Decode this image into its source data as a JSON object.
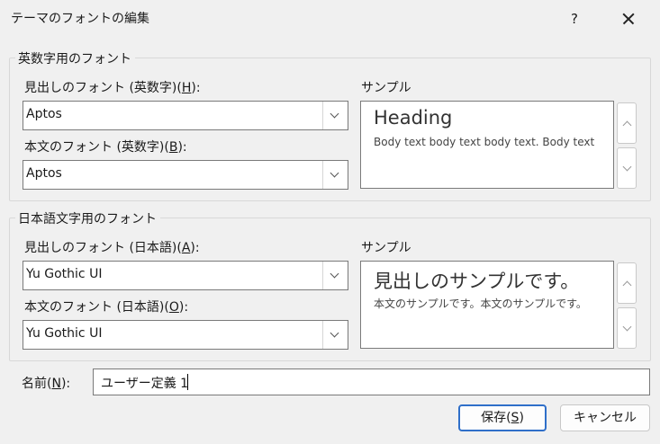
{
  "window": {
    "title": "テーマのフォントの編集",
    "help": "?"
  },
  "latin": {
    "group_label": "英数字用のフォント",
    "heading_label_pre": "見出しのフォント (英数字)(",
    "heading_label_key": "H",
    "heading_label_post": "):",
    "heading_value": "Aptos",
    "body_label_pre": "本文のフォント (英数字)(",
    "body_label_key": "B",
    "body_label_post": "):",
    "body_value": "Aptos",
    "sample_label": "サンプル",
    "sample_heading": "Heading",
    "sample_body": "Body text body text body text. Body text"
  },
  "japanese": {
    "group_label": "日本語文字用のフォント",
    "heading_label_pre": "見出しのフォント (日本語)(",
    "heading_label_key": "A",
    "heading_label_post": "):",
    "heading_value": "Yu Gothic UI",
    "body_label_pre": "本文のフォント (日本語)(",
    "body_label_key": "O",
    "body_label_post": "):",
    "body_value": "Yu Gothic UI",
    "sample_label": "サンプル",
    "sample_heading": "見出しのサンプルです。",
    "sample_body": "本文のサンプルです。本文のサンプルです。"
  },
  "name": {
    "label_pre": "名前(",
    "label_key": "N",
    "label_post": "):",
    "value": "ユーザー定義 1"
  },
  "buttons": {
    "save_pre": "保存(",
    "save_key": "S",
    "save_post": ")",
    "cancel": "キャンセル"
  },
  "colors": {
    "accent": "#2f6fc9"
  }
}
